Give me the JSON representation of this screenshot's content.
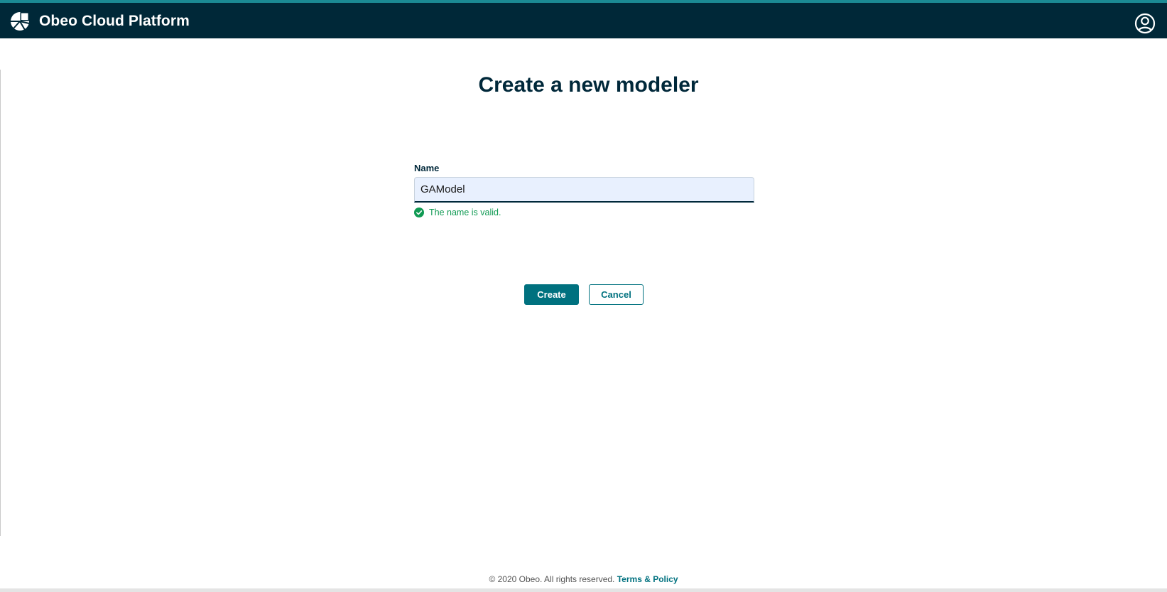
{
  "header": {
    "app_title": "Obeo Cloud Platform",
    "logo_icon": "obeo-logo-icon",
    "account_icon": "account-circle-icon"
  },
  "main": {
    "page_title": "Create a new modeler",
    "form": {
      "name_label": "Name",
      "name_value": "GAModel",
      "validation_message": "The name is valid.",
      "validation_icon": "check-circle-icon"
    },
    "buttons": {
      "create_label": "Create",
      "cancel_label": "Cancel"
    }
  },
  "footer": {
    "copyright": "© 2020 Obeo. All rights reserved.",
    "link_text": "Terms & Policy"
  },
  "colors": {
    "header_bg": "#002838",
    "header_accent": "#1b8a94",
    "primary": "#00717f",
    "success": "#109a53",
    "title": "#00283a"
  }
}
